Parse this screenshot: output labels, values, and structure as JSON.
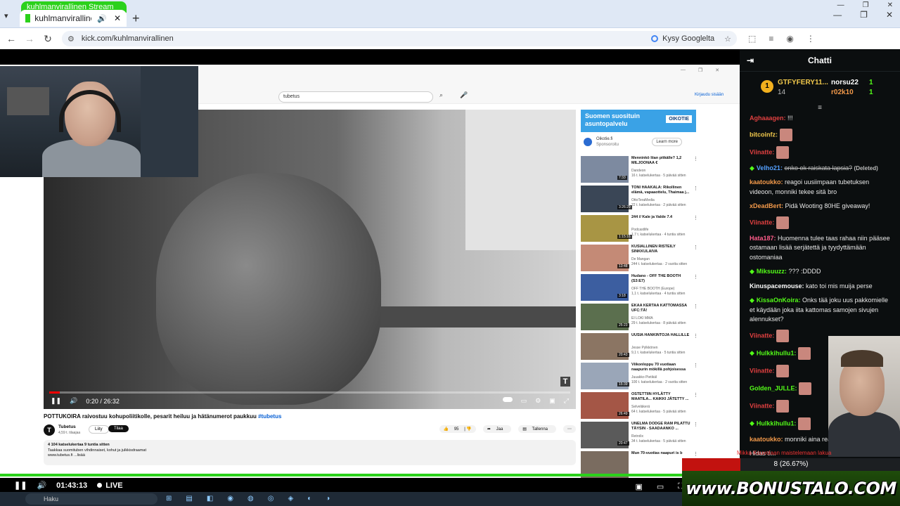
{
  "browser": {
    "ghost_tab_title": "kuhlmanvirallinen Stream",
    "tab_title": "kuhlmanvirallinen Stream",
    "url": "kick.com/kuhlmanvirallinen",
    "google_label": "Kysy Googlelta"
  },
  "youtube": {
    "search_value": "tubetus",
    "signin_label": "Kirjaudu sisään",
    "video_time": "0:20 / 26:32",
    "video_title": "POTTUKOIRA raivostuu kohupoliitikolle, pesarit heiluu ja hätänumerot paukkuu",
    "video_tag": "#tubetus",
    "channel_name": "Tubetus",
    "channel_subs": "4,59 t. tilaajaa",
    "join_label": "Liity",
    "subscribe_label": "Tilaa",
    "likes": "95",
    "share_label": "Jaa",
    "save_label": "Tallenna",
    "desc_stats": "4 104 katselukertaa  9 tuntia sitten",
    "desc_line1": "Taakkaa suomituben vihdinnaiset, kohut ja julkkisdraamat",
    "desc_line2": "www.tubetus.fi ...lisää",
    "ad_title": "Suomen suosituin asuntopalvelu",
    "ad_brand": "OIKOTIE",
    "ad_sponsor": "Oikotie.fi",
    "ad_sponsor_sub": "Sponsoroitu",
    "ad_learn": "Learn more",
    "recs": [
      {
        "title": "Menninkö liian pitkälle? 1,2 MILJOONAA €",
        "channel": "Dandeon",
        "meta": "16 t. katselukertaa · 5 päivää sitten",
        "dur": "7:33"
      },
      {
        "title": "TONI HAAKALA: Rikollinen elämä, vapaaottelu, Thaimaa j...",
        "channel": "OttoTeraMedia",
        "meta": "22 t. katselukertaa · 2 päivää sitten",
        "dur": "3:26:29"
      },
      {
        "title": "244 // Kale ja Valde 7.4",
        "channel": "Podcastlife",
        "meta": "1,7 t. katselukertaa · 4 tuntia sitten",
        "dur": "1:15:16"
      },
      {
        "title": "KUSIALLINEN RISTEILY SINKKULAIVA",
        "channel": "De Mangan",
        "meta": "244 t. katselukertaa · 2 vuotta sitten",
        "dur": "13:48"
      },
      {
        "title": "Hudano - OFF THE BOOTH (S3:E7)",
        "channel": "OFF THE BOOTH (Europe)",
        "meta": "1,1 t. katselukertaa · 4 tuntia sitten",
        "dur": "3:18"
      },
      {
        "title": "EKAA KERTAA KATTOMASSA UFC:TÄ!",
        "channel": "EI LOKI MMA",
        "meta": "29 t. katselukertaa · 8 päivää sitten",
        "dur": "25:23"
      },
      {
        "title": "UUSIA HANKINTOJA HALLILLE",
        "channel": "Jesse Pylkkönen",
        "meta": "9,1 t. katselukertaa · 5 tuntia sitten",
        "dur": "20:43"
      },
      {
        "title": "Viikonloppu 70 vuotiaan naapurin mökillä pohjoisessa",
        "channel": "Juuakko Pietikäl",
        "meta": "100 t. katselukertaa · 2 vuotta sitten",
        "dur": "15:39"
      },
      {
        "title": "OSTETTIIN HYLÄTTY MAATILA... KAIKKI JÄTETTY ...",
        "channel": "Selveläkerä",
        "meta": "64 t. katselukertaa · 5 päivää sitten",
        "dur": "26:49"
      },
      {
        "title": "UNELMA DODGE RAM PILATTU TÄYSIN - SAADAANKO ...",
        "channel": "Retrolix",
        "meta": "34 t. katselukertaa · 5 päivää sitten",
        "dur": "20:47"
      },
      {
        "title": "Mun 70-vuotias naapuri is b",
        "channel": "",
        "meta": "",
        "dur": ""
      }
    ]
  },
  "player": {
    "time": "01:43:13",
    "live_label": "LIVE"
  },
  "taskbar": {
    "search_label": "Haku"
  },
  "chat": {
    "title": "Chatti",
    "pinned": {
      "u1": "GTFYFERY11...",
      "u1_count": "14",
      "u2": "norsu22",
      "u2_count": "1",
      "u3": "r02k10",
      "u3_count": "1",
      "rank": "1"
    },
    "messages": [
      {
        "user": "Aghaaagen:",
        "color": "#e04040",
        "text": "!!!",
        "emote": false
      },
      {
        "user": "bitcoinfz:",
        "color": "#f2c94c",
        "text": "",
        "emote": true
      },
      {
        "user": "Viinatte:",
        "color": "#e04040",
        "text": "",
        "emote": true
      },
      {
        "user": "Velho21:",
        "color": "#53a0ff",
        "text": "onko ok raiskata lapsia?",
        "deleted": true,
        "badge": true
      },
      {
        "user": "kaatoukko:",
        "color": "#f2994a",
        "text": "reagoi uusiimpaan tubetuksen videoon, monniki tekee sitä bro"
      },
      {
        "user": "xDeadBert:",
        "color": "#f2994a",
        "text": "Pidä Wooting 80HE giveaway!"
      },
      {
        "user": "Viinatte:",
        "color": "#e04040",
        "text": "",
        "emote": true
      },
      {
        "user": "Hata187:",
        "color": "#ff5c8a",
        "text": "Huomenna tulee taas rahaa niin pääsee ostamaan lisää serjätettä ja tyydyttämään ostomaniaa"
      },
      {
        "user": "Miksuuzz:",
        "color": "#53fc18",
        "text": "??? :DDDD",
        "badge": true
      },
      {
        "user": "Kinuspacemouse:",
        "color": "#ffffff",
        "text": "kato toi mis muija perse"
      },
      {
        "user": "KissaOnKoira:",
        "color": "#53fc18",
        "text": "Onks tää joku uus pakkomielle et käydään joka iita kattomas samojen sivujen alennukset?",
        "badge": true
      },
      {
        "user": "Viinatte:",
        "color": "#e04040",
        "text": "",
        "emote": true
      },
      {
        "user": "Hulkkihullu1:",
        "color": "#53fc18",
        "text": "",
        "emote": true,
        "badge": true
      },
      {
        "user": "Viinatte:",
        "color": "#e04040",
        "text": "",
        "emote": true
      },
      {
        "user": "Golden_JULLE:",
        "color": "#53fc18",
        "text": "",
        "emote": true
      },
      {
        "user": "Viinatte:",
        "color": "#e04040",
        "text": "",
        "emote": true
      },
      {
        "user": "Hulkkihullu1:",
        "color": "#53fc18",
        "text": "",
        "emote": true,
        "badge": true
      },
      {
        "user": "kaatoukko:",
        "color": "#f2994a",
        "text": "monniki aina reag ottaa tän tavaksi"
      },
      {
        "user": "",
        "color": "#bbb",
        "text": "Hidas ti..."
      }
    ],
    "poll_question": "Mikka Kouvolaan maistelemaan lakua",
    "poll_result": "8 (26.67%)",
    "poll_fraction": 0.2667
  },
  "banner": {
    "text": "www.BONUSTALO.COM"
  }
}
